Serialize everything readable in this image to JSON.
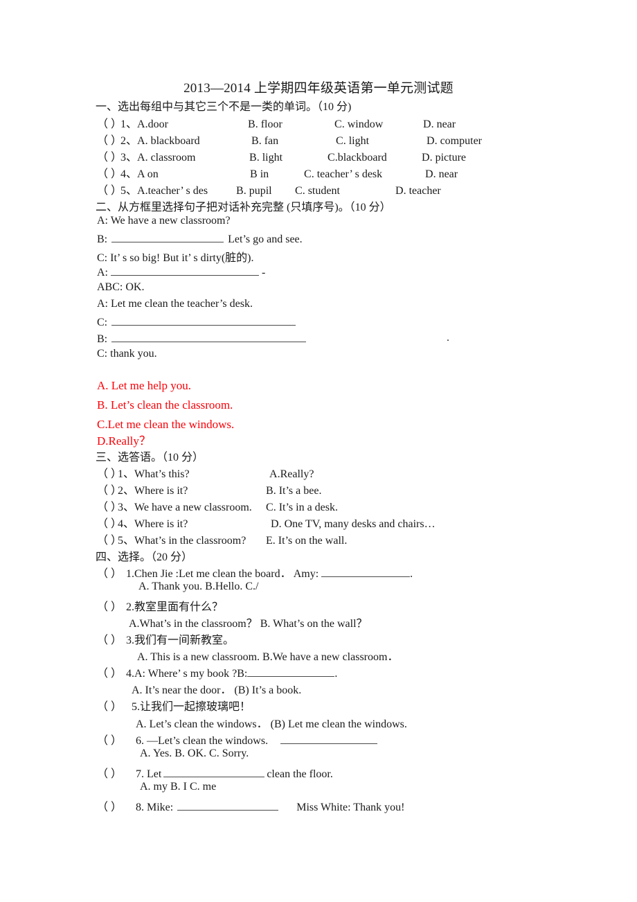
{
  "document": {
    "title": "2013—2014 上学期四年级英语第一单元测试题"
  },
  "section1": {
    "heading": "一、选出每组中与其它三个不是一类的单词。（10 分)",
    "items": [
      {
        "paren": "（   ）",
        "num": "1、",
        "a": "A.door",
        "b": "B. floor",
        "c": "C. window",
        "d": "D. near"
      },
      {
        "paren": "（   ）",
        "num": "2、",
        "a": "A. blackboard",
        "b": "B. fan",
        "c": "C. light",
        "d": "D. computer"
      },
      {
        "paren": "（   ）",
        "num": "3、",
        "a": "A. classroom",
        "b": "B. light",
        "c": "C.blackboard",
        "d": "D. picture"
      },
      {
        "paren": "（   ）",
        "num": "4、",
        "a": "A on",
        "b": "B in",
        "c": "C. teacher’ s desk",
        "d": "D. near"
      },
      {
        "paren": "（   ）",
        "num": "5、",
        "a": "A.teacher’ s des",
        "b": "B. pupil",
        "c": "C. student",
        "d": "D. teacher"
      }
    ]
  },
  "section2": {
    "heading": "二、从方框里选择句子把对话补充完整 (只填序号)。（10 分）",
    "dialogue": [
      {
        "speaker": "A: We have a new classroom?"
      },
      {
        "speaker": "B:",
        "blank": true,
        "after": "Let’s go and see."
      },
      {
        "speaker": "C: It’ s so big! But it’ s dirty(脏的)."
      },
      {
        "speaker": "A:",
        "blank": true,
        "after": "-"
      },
      {
        "speaker": "ABC: OK."
      },
      {
        "speaker": "A: Let me clean the teacher’s desk."
      },
      {
        "speaker": "C:",
        "blank": true,
        "after": ""
      },
      {
        "speaker": "B:",
        "blank": true,
        "after": ""
      },
      {
        "speaker": "C: thank you."
      }
    ],
    "stray_period": ".",
    "options": [
      "A. Let me help you.",
      "B. Let’s clean the classroom.",
      "C.Let me clean the windows.",
      "D.Really？"
    ],
    "options_color": "#fb0007"
  },
  "section3": {
    "heading": "三、选答语。（10 分）",
    "items": [
      {
        "paren": "（  ）",
        "num": "1、",
        "question": "What’s this?",
        "answer": "A.Really?"
      },
      {
        "paren": "（  ）",
        "num": "2、",
        "question": "Where is it?",
        "answer": "B. It’s a bee."
      },
      {
        "paren": "（  ）",
        "num": "3、",
        "question": "We have a new classroom.",
        "answer": "C.   It’s in a desk."
      },
      {
        "paren": "（  ）",
        "num": "4、",
        "question": "Where is it?",
        "answer": "D. One TV, many desks and chairs…"
      },
      {
        "paren": "（  ）",
        "num": "5、",
        "question": "What’s in the classroom?",
        "answer": "E. It’s on the wall."
      }
    ]
  },
  "section4": {
    "heading": "四、选择。（20 分）",
    "items": [
      {
        "paren": "（    ）",
        "stem_before": "1.Chen Jie :Let   me   clean   the   board．  Amy:",
        "stem_blank": true,
        "stem_after": ".",
        "options": "A. Thank you.    B.Hello.   C./"
      },
      {
        "paren": "（    ）",
        "stem_before": "2.教室里面有什么？",
        "stem_blank": false,
        "stem_after": "",
        "options": "A.What’s   in   the   classroom？ B. What’s   on   the   wall？"
      },
      {
        "paren": "（    ）",
        "stem_before": "3.我们有一间新教室。",
        "stem_blank": false,
        "stem_after": "",
        "options": "A. This is a new classroom. B.We   have   a   new   classroom．"
      },
      {
        "paren": "（    ）",
        "stem_before": "4.A: Where’ s   my   book ?B:",
        "stem_blank": true,
        "stem_after": ".",
        "options": "A. It’s   near   the   door．    (B) It’s   a book."
      },
      {
        "paren": "（    ）",
        "stem_before": "5.让我们一起擦玻璃吧！",
        "stem_blank": false,
        "stem_after": "",
        "options": "A. Let’s   clean   the   windows．   (B) Let   me   clean   the   windows."
      },
      {
        "paren": "（     ）",
        "stem_before": "6. —Let’s clean the windows.",
        "stem_blank": true,
        "stem_after": "",
        "options": "A. Yes.        B. OK.      C. Sorry."
      },
      {
        "paren": "（     ）",
        "stem_before": "7. Let",
        "stem_blank": true,
        "stem_after": "clean the floor.",
        "options": "A. my       B. I      C. me"
      },
      {
        "paren": "（     ）",
        "stem_before": "8. Mike:",
        "stem_blank": true,
        "stem_after": "Miss White: Thank you!",
        "options": ""
      }
    ]
  }
}
